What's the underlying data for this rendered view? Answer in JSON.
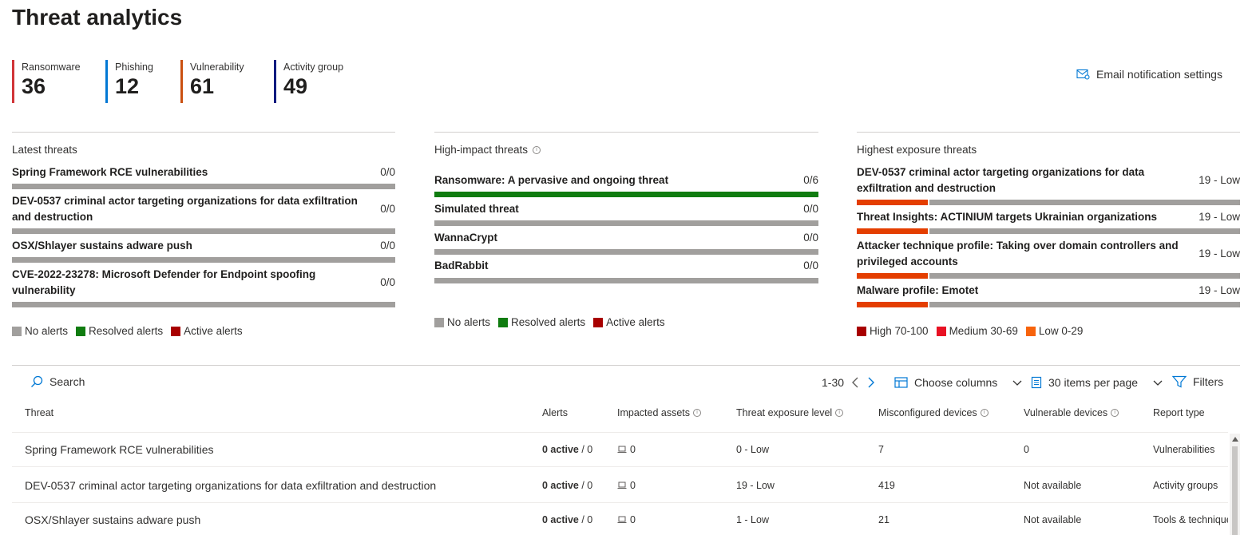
{
  "page": {
    "title": "Threat analytics"
  },
  "stats": [
    {
      "label": "Ransomware",
      "value": "36",
      "color": "#d13438"
    },
    {
      "label": "Phishing",
      "value": "12",
      "color": "#0078d4"
    },
    {
      "label": "Vulnerability",
      "value": "61",
      "color": "#ca5010"
    },
    {
      "label": "Activity group",
      "value": "49",
      "color": "#0b1b7f"
    }
  ],
  "email_settings": {
    "label": "Email notification settings",
    "icon": "mail-settings-icon"
  },
  "latest": {
    "title": "Latest threats",
    "rows": [
      {
        "name": "Spring Framework RCE vulnerabilities",
        "value": "0/0",
        "resolved_fraction": 0
      },
      {
        "name": "DEV-0537 criminal actor targeting organizations for data exfiltration and destruction",
        "value": "0/0",
        "resolved_fraction": 0
      },
      {
        "name": "OSX/Shlayer sustains adware push",
        "value": "0/0",
        "resolved_fraction": 0
      },
      {
        "name": "CVE-2022-23278: Microsoft Defender for Endpoint spoofing vulnerability",
        "value": "0/0",
        "resolved_fraction": 0
      }
    ],
    "legend": [
      {
        "label": "No alerts",
        "color": "#a19f9d"
      },
      {
        "label": "Resolved alerts",
        "color": "#107c10"
      },
      {
        "label": "Active alerts",
        "color": "#a80000"
      }
    ]
  },
  "highimpact": {
    "title": "High-impact threats",
    "rows": [
      {
        "name": "Ransomware: A pervasive and ongoing threat",
        "value": "0/6",
        "resolved_fraction": 1
      },
      {
        "name": "Simulated threat",
        "value": "0/0",
        "resolved_fraction": 0
      },
      {
        "name": "WannaCrypt",
        "value": "0/0",
        "resolved_fraction": 0
      },
      {
        "name": "BadRabbit",
        "value": "0/0",
        "resolved_fraction": 0
      }
    ],
    "legend": [
      {
        "label": "No alerts",
        "color": "#a19f9d"
      },
      {
        "label": "Resolved alerts",
        "color": "#107c10"
      },
      {
        "label": "Active alerts",
        "color": "#a80000"
      }
    ]
  },
  "exposure": {
    "title": "Highest exposure threats",
    "rows": [
      {
        "name": "DEV-0537 criminal actor targeting organizations for data exfiltration and destruction",
        "value": "19 - Low",
        "fraction": 0.19
      },
      {
        "name": "Threat Insights: ACTINIUM targets Ukrainian organizations",
        "value": "19 - Low",
        "fraction": 0.19
      },
      {
        "name": "Attacker technique profile: Taking over domain controllers and privileged accounts",
        "value": "19 - Low",
        "fraction": 0.19
      },
      {
        "name": "Malware profile: Emotet",
        "value": "19 - Low",
        "fraction": 0.19
      }
    ],
    "fill_color": "#e43e00",
    "legend": [
      {
        "label": "High 70-100",
        "color": "#a80000"
      },
      {
        "label": "Medium 30-69",
        "color": "#e81123"
      },
      {
        "label": "Low 0-29",
        "color": "#f7630c"
      }
    ]
  },
  "toolbar": {
    "search": "Search",
    "range": "1-30",
    "choose_columns": "Choose columns",
    "items_per_page": "30 items per page",
    "filters": "Filters"
  },
  "table": {
    "columns": [
      "Threat",
      "Alerts",
      "Impacted assets",
      "Threat exposure level",
      "Misconfigured devices",
      "Vulnerable devices",
      "Report type"
    ],
    "rows": [
      {
        "threat": "Spring Framework RCE vulnerabilities",
        "alerts_active": "0 active",
        "alerts_total": " / 0",
        "assets": "0",
        "exposure": "0 - Low",
        "misconfigured": "7",
        "vulnerable": "0",
        "report": "Vulnerabilities"
      },
      {
        "threat": "DEV-0537 criminal actor targeting organizations for data exfiltration and destruction",
        "alerts_active": "0 active",
        "alerts_total": " / 0",
        "assets": "0",
        "exposure": "19 - Low",
        "misconfigured": "419",
        "vulnerable": "Not available",
        "report": "Activity groups"
      },
      {
        "threat": "OSX/Shlayer sustains adware push",
        "alerts_active": "0 active",
        "alerts_total": " / 0",
        "assets": "0",
        "exposure": "1 - Low",
        "misconfigured": "21",
        "vulnerable": "Not available",
        "report": "Tools & techniques"
      }
    ]
  }
}
